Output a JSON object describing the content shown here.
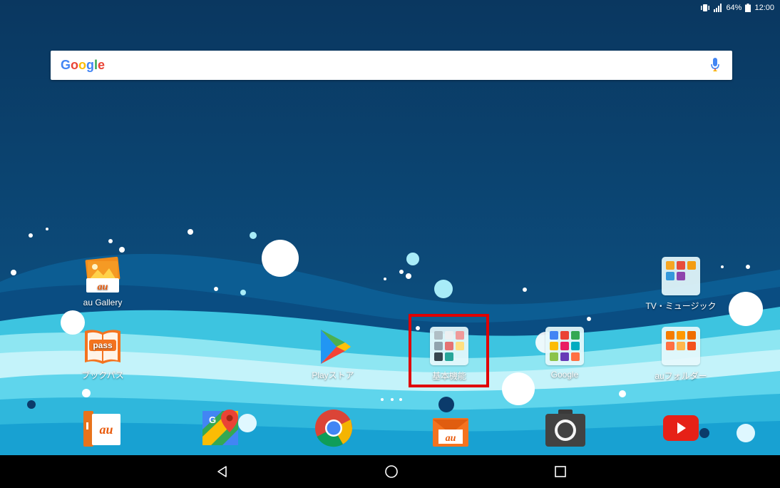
{
  "status_bar": {
    "battery_percent": "64%",
    "time": "12:00"
  },
  "search": {
    "logo_text": "Google",
    "mic_icon": "mic-icon"
  },
  "apps": {
    "au_gallery": "au Gallery",
    "tv_music": "TV・ミュージック",
    "book_pass": "ブックパス",
    "play_store": "Playストア",
    "basic_functions": "基本機能",
    "google": "Google",
    "au_folder": "auフォルダー"
  },
  "icon_text": {
    "au_logo": "au",
    "pass_logo": "pass",
    "maps_g": "G"
  },
  "dock": [
    "au-app-icon",
    "maps-icon",
    "chrome-icon",
    "au-mail-icon",
    "camera-icon",
    "youtube-icon"
  ],
  "nav": [
    "back-icon",
    "home-icon",
    "recents-icon"
  ],
  "colors": {
    "highlight": "#e00000",
    "google_blue": "#4285f4",
    "google_red": "#ea4335",
    "google_yellow": "#fbbc05",
    "google_green": "#34a853"
  }
}
